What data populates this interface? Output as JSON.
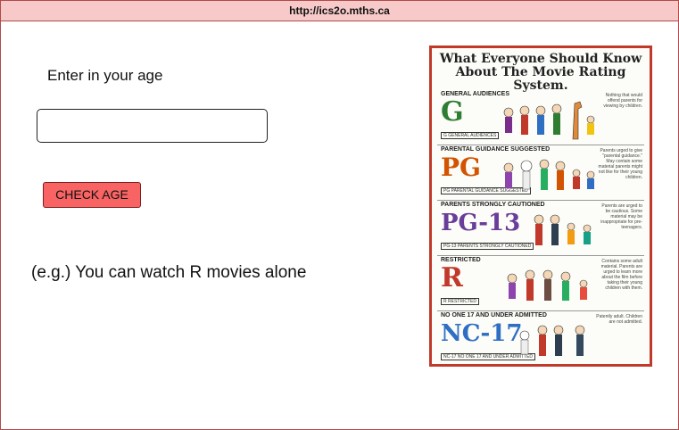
{
  "browser": {
    "url": "http://ics2o.mths.ca"
  },
  "form": {
    "prompt_label": "Enter in your age",
    "age_value": "",
    "check_button_label": "CHECK AGE",
    "result_text": "(e.g.) You can watch R movies alone"
  },
  "poster": {
    "title_line1": "What Everyone Should Know",
    "title_line2": "About The Movie Rating System.",
    "ratings": [
      {
        "heading": "GENERAL AUDIENCES",
        "letter": "G",
        "badge": "G GENERAL AUDIENCES",
        "color": "#2e7d32",
        "note": "Nothing that would offend parents for viewing by children."
      },
      {
        "heading": "PARENTAL GUIDANCE SUGGESTED",
        "letter": "PG",
        "badge": "PG PARENTAL GUIDANCE SUGGESTED",
        "color": "#d35400",
        "note": "Parents urged to give \"parental guidance.\" May contain some material parents might not like for their young children."
      },
      {
        "heading": "PARENTS STRONGLY CAUTIONED",
        "letter": "PG-13",
        "badge": "PG-13 PARENTS STRONGLY CAUTIONED",
        "color": "#6a3d9a",
        "note": "Parents are urged to be cautious. Some material may be inappropriate for pre-teenagers."
      },
      {
        "heading": "RESTRICTED",
        "letter": "R",
        "badge": "R RESTRICTED",
        "color": "#c0392b",
        "note": "Contains some adult material. Parents are urged to learn more about the film before taking their young children with them."
      },
      {
        "heading": "NO ONE 17 AND UNDER ADMITTED",
        "letter": "NC-17",
        "badge": "NC-17 NO ONE 17 AND UNDER ADMITTED",
        "color": "#2e6fc4",
        "note": "Patently adult. Children are not admitted."
      }
    ]
  }
}
